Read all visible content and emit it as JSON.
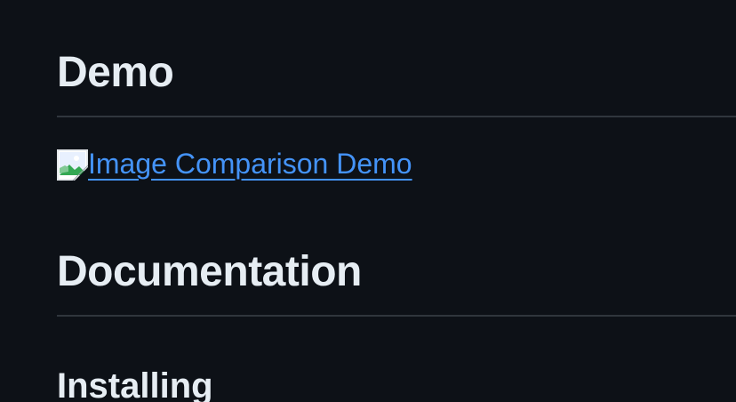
{
  "sections": {
    "demo_heading": "Demo",
    "demo_link": {
      "alt_text": "Image Comparison Demo"
    },
    "documentation_heading": "Documentation",
    "installing_heading": "Installing"
  },
  "colors": {
    "background": "#0d1117",
    "text": "#e6edf3",
    "link": "#4493f8",
    "divider": "#30363d"
  },
  "icons": {
    "broken_image": "broken-image-icon"
  }
}
